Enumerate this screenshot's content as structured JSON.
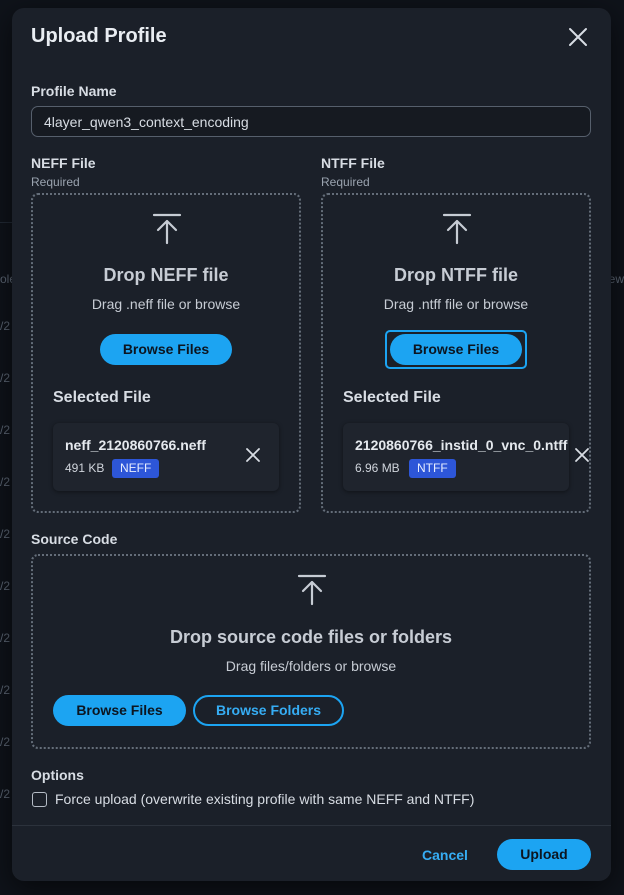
{
  "background": {
    "left_fragments": [
      "/2",
      "/2",
      "/2",
      "/2",
      "/2",
      "/2",
      "/2",
      "/2",
      "/2",
      "/2"
    ],
    "left_header": "ole",
    "right_header": "ew"
  },
  "modal": {
    "title": "Upload Profile",
    "close_icon": "close-icon"
  },
  "profile_name": {
    "label": "Profile Name",
    "value": "4layer_qwen3_context_encoding"
  },
  "neff": {
    "label": "NEFF File",
    "required": "Required",
    "drop_title": "Drop NEFF file",
    "drop_sub": "Drag .neff file or browse",
    "browse_label": "Browse Files",
    "selected_title": "Selected File",
    "file_name": "neff_2120860766.neff",
    "file_size": "491 KB",
    "badge": "NEFF"
  },
  "ntff": {
    "label": "NTFF File",
    "required": "Required",
    "drop_title": "Drop NTFF file",
    "drop_sub": "Drag .ntff file or browse",
    "browse_label": "Browse Files",
    "selected_title": "Selected File",
    "file_name": "2120860766_instid_0_vnc_0.ntff",
    "file_size": "6.96 MB",
    "badge": "NTFF"
  },
  "source_code": {
    "label": "Source Code",
    "drop_title": "Drop source code files or folders",
    "drop_sub": "Drag files/folders or browse",
    "browse_files_label": "Browse Files",
    "browse_folders_label": "Browse Folders"
  },
  "options": {
    "label": "Options",
    "force_upload_label": "Force upload (overwrite existing profile with same NEFF and NTFF)",
    "force_upload_checked": false
  },
  "footer": {
    "cancel_label": "Cancel",
    "upload_label": "Upload"
  },
  "colors": {
    "accent": "#1ca4f2",
    "badge": "#2d56d8",
    "modal_bg": "#1b2029"
  }
}
